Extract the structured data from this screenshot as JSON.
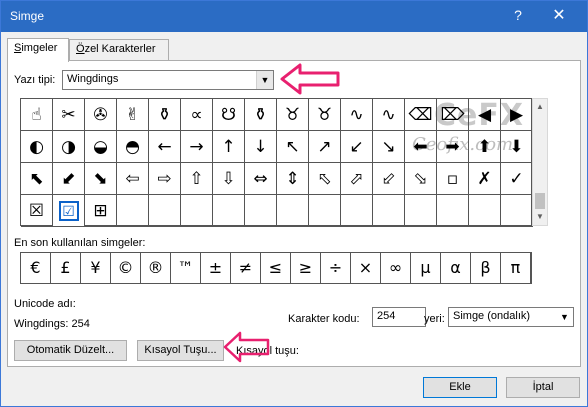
{
  "window": {
    "title": "Simge",
    "help": "?",
    "close": "✕"
  },
  "tabs": [
    {
      "label": "Simgeler",
      "underline": "S",
      "rest": "imgeler",
      "active": true
    },
    {
      "label": "Özel Karakterler",
      "underline": "Ö",
      "rest": "zel Karakterler",
      "active": false
    }
  ],
  "font": {
    "label": "Yazı tipi:",
    "value": "Wingdings"
  },
  "watermark": {
    "big": "CeFX",
    "small": "Ceofix.com"
  },
  "symbol_grid": {
    "rows": [
      [
        "☝",
        "✂",
        "✇",
        "✌",
        "⚱",
        "∝",
        "☋",
        "⚱",
        "♉",
        "♉",
        "∿",
        "∿",
        "⌫",
        "⌦",
        "◀",
        "▶"
      ],
      [
        "◐",
        "◑",
        "◒",
        "◓",
        "←",
        "→",
        "↑",
        "↓",
        "↖",
        "↗",
        "↙",
        "↘",
        "⬅",
        "➡",
        "⬆",
        "⬇"
      ],
      [
        "⬉",
        "⬋",
        "⬊",
        "⇦",
        "⇨",
        "⇧",
        "⇩",
        "⇔",
        "⇕",
        "⬁",
        "⬀",
        "⬃",
        "⬂",
        "▫",
        "✗",
        "✓"
      ],
      [
        "☒",
        "☑",
        "⊞",
        "",
        "",
        "",
        "",
        "",
        "",
        "",
        "",
        "",
        "",
        "",
        "",
        ""
      ]
    ],
    "selected": {
      "row": 3,
      "col": 1
    }
  },
  "recent": {
    "label": "En son kullanılan simgeler:",
    "items": [
      "€",
      "£",
      "¥",
      "©",
      "®",
      "™",
      "±",
      "≠",
      "≤",
      "≥",
      "÷",
      "×",
      "∞",
      "µ",
      "α",
      "β",
      "π"
    ]
  },
  "unicode": {
    "label": "Unicode adı:",
    "value": "Wingdings: 254"
  },
  "charcode": {
    "label": "Karakter kodu:",
    "value": "254",
    "from_label": "yeri:",
    "from_value": "Simge (ondalık)"
  },
  "buttons": {
    "autocorrect": "Otomatik Düzelt...",
    "shortcut_key": "Kısayol Tuşu...",
    "shortcut_label": "Kısayol tuşu:",
    "insert": "Ekle",
    "cancel": "İptal"
  },
  "colors": {
    "titlebar": "#2b6cc4",
    "selection": "#0b62c9",
    "arrow": "#e8206f"
  }
}
